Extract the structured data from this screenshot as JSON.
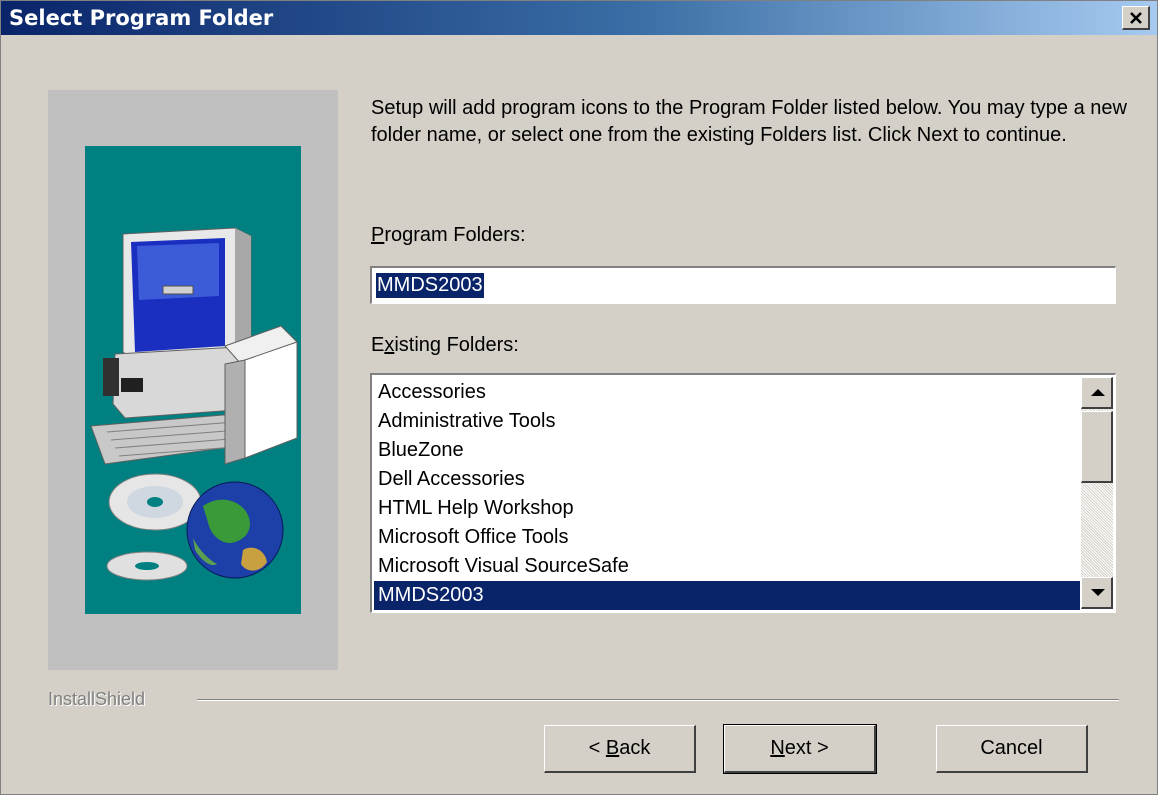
{
  "window": {
    "title": "Select Program Folder",
    "close_glyph": "close-icon"
  },
  "intro_text": "Setup will add program icons to the Program Folder listed below.  You may type a new folder name, or select one from the existing Folders list.  Click Next to continue.",
  "program_folders": {
    "label_hotkey": "P",
    "label_rest": "rogram Folders:",
    "value": "MMDS2003"
  },
  "existing_folders": {
    "label_pre": "E",
    "label_hotkey": "x",
    "label_rest": "isting Folders:",
    "items": [
      "Accessories",
      "Administrative Tools",
      "BlueZone",
      "Dell Accessories",
      "HTML Help Workshop",
      "Microsoft Office Tools",
      "Microsoft Visual SourceSafe",
      "MMDS2003"
    ],
    "selected": "MMDS2003"
  },
  "footer": {
    "brand": "InstallShield"
  },
  "buttons": {
    "back_prefix": "< ",
    "back_hotkey": "B",
    "back_rest": "ack",
    "next_hotkey": "N",
    "next_rest": "ext >",
    "cancel": "Cancel"
  },
  "colors": {
    "titlebar_start": "#0a246a",
    "titlebar_end": "#a6caf0",
    "dialog_bg": "#d4d0c8",
    "selection": "#0a246a",
    "art_teal": "#008080"
  }
}
